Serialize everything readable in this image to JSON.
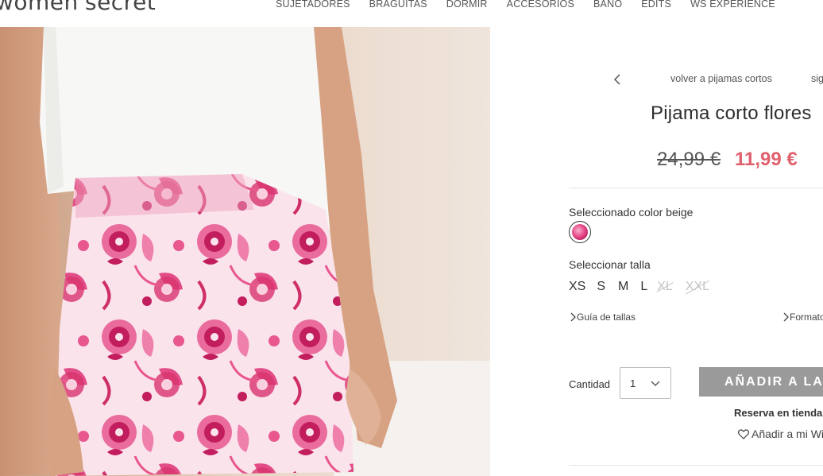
{
  "header": {
    "logo": "women'secret",
    "nav": [
      "SUJETADORES",
      "BRAGUITAS",
      "DORMIR",
      "ACCESORIOS",
      "BAÑO",
      "EDITS",
      "WS EXPERIENCE"
    ]
  },
  "breadcrumb": {
    "back_label": "volver a pijamas cortos",
    "next_label": "siguiente"
  },
  "product": {
    "title": "Pijama corto flores",
    "price_old": "24,99 €",
    "price_new": "11,99 €",
    "color_label": "Seleccionado color beige",
    "size_label": "Seleccionar talla",
    "sizes": [
      {
        "label": "XS",
        "available": true
      },
      {
        "label": "S",
        "available": true
      },
      {
        "label": "M",
        "available": true
      },
      {
        "label": "L",
        "available": true
      },
      {
        "label": "XL",
        "available": false
      },
      {
        "label": "XXL",
        "available": false
      }
    ],
    "size_guide": "Guía de tallas",
    "format_link": "Formato"
  },
  "purchase": {
    "qty_label": "Cantidad",
    "qty_value": "1",
    "add_button": "AÑADIR A LA CESTA",
    "reserve": "Reserva en tienda",
    "wishlist": "Añadir a mi Wishlist"
  },
  "colors": {
    "sale": "#e0606c",
    "button": "#9a9a9a",
    "swatch": "#e84c8c"
  }
}
